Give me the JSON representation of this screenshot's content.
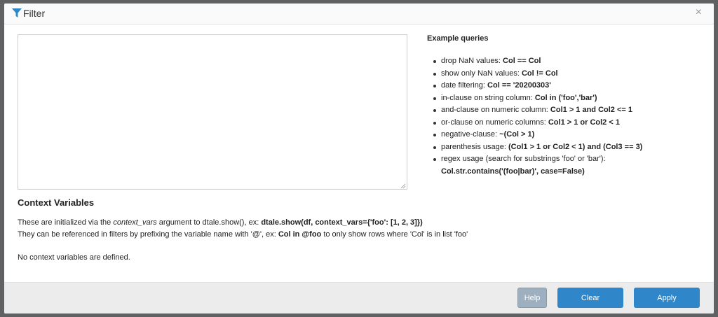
{
  "dialog": {
    "title": "Filter",
    "close_glyph": "×"
  },
  "icons": {
    "filter": "filter-icon",
    "close": "close-icon"
  },
  "query": {
    "value": "",
    "placeholder": ""
  },
  "examples": {
    "heading": "Example queries",
    "items": [
      {
        "label": "drop NaN values: ",
        "code": "Col == Col"
      },
      {
        "label": "show only NaN values: ",
        "code": "Col != Col"
      },
      {
        "label": "date filtering: ",
        "code": "Col == '20200303'"
      },
      {
        "label": "in-clause on string column: ",
        "code": "Col in ('foo','bar')"
      },
      {
        "label": "and-clause on numeric column: ",
        "code": "Col1 > 1 and Col2 <= 1"
      },
      {
        "label": "or-clause on numeric columns: ",
        "code": "Col1 > 1 or Col2 < 1"
      },
      {
        "label": "negative-clause: ",
        "code": "~(Col > 1)"
      },
      {
        "label": "parenthesis usage: ",
        "code": "(Col1 > 1 or Col2 < 1) and (Col3 == 3)"
      },
      {
        "label": "regex usage (search for substrings 'foo' or 'bar'): ",
        "code": "Col.str.contains('(foo|bar)', case=False)"
      }
    ]
  },
  "context": {
    "heading": "Context Variables",
    "line1_pre": "These are initialized via the ",
    "line1_em": "context_vars",
    "line1_mid": " argument to dtale.show(), ex: ",
    "line1_code": "dtale.show(df, context_vars={'foo': [1, 2, 3]})",
    "line2_pre": "They can be referenced in filters by prefixing the variable name with '@', ex: ",
    "line2_code": "Col in @foo",
    "line2_post": " to only show rows where 'Col' is in list 'foo'",
    "none_text": "No context variables are defined."
  },
  "footer": {
    "help_label": "Help",
    "clear_label": "Clear",
    "apply_label": "Apply"
  },
  "colors": {
    "primary": "#2f86c8",
    "help": "#9eb0c0",
    "overlay": "#5f6163"
  }
}
